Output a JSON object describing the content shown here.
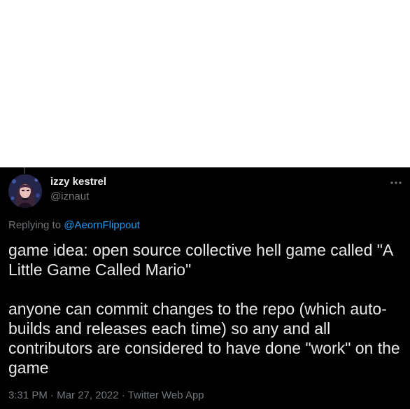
{
  "tweet": {
    "author_name": "izzy kestrel",
    "author_handle": "@iznaut",
    "reply_prefix": "Replying to",
    "reply_mention": "@AeornFlippout",
    "paragraphs": [
      "game idea: open source collective hell game called \"A Little Game Called Mario\"",
      "anyone can commit changes to the repo (which auto-builds and releases each time) so any and all contributors are considered to have done \"work\" on the game"
    ],
    "time": "3:31 PM",
    "date": "Mar 27, 2022",
    "source": "Twitter Web App",
    "separator": "·"
  },
  "icons": {
    "avatar": "avatar-image",
    "more": "more-options-icon"
  },
  "colors": {
    "background": "#000000",
    "primary_text": "#e7e9ea",
    "secondary_text": "#71767b",
    "link": "#1d9bf0"
  }
}
